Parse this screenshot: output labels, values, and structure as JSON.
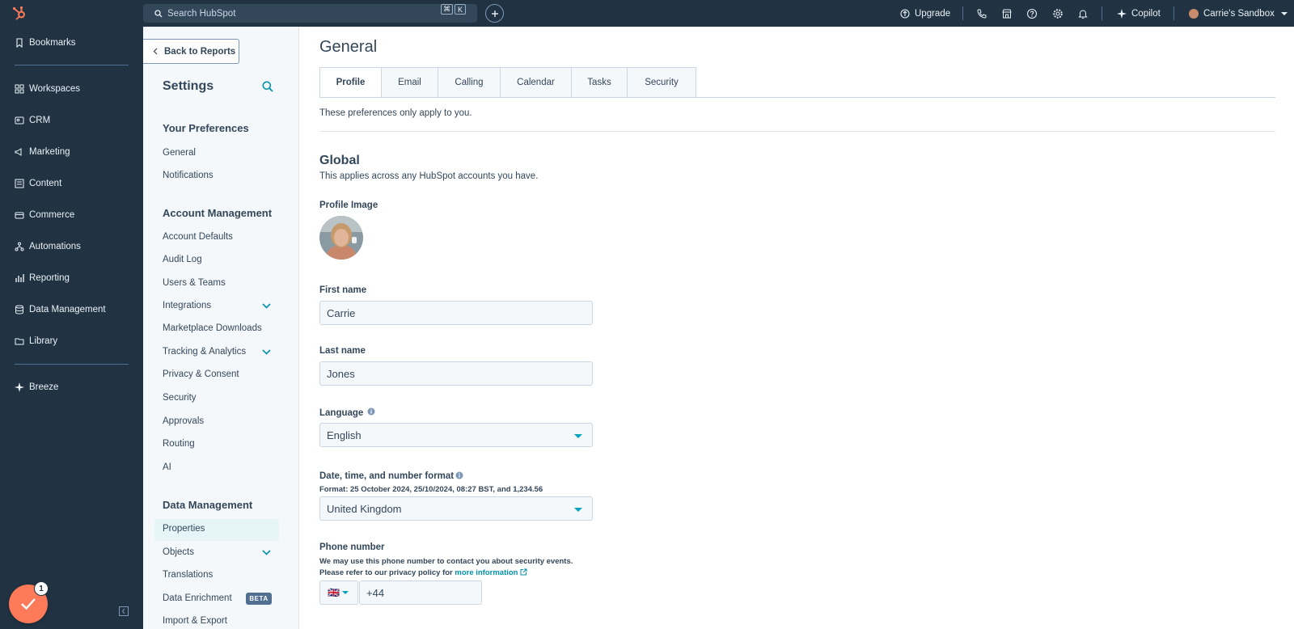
{
  "topbar": {
    "search_placeholder": "Search HubSpot",
    "shortcut_cmd": "⌘",
    "shortcut_key": "K",
    "upgrade": "Upgrade",
    "copilot": "Copilot",
    "account": "Carrie's Sandbox"
  },
  "leftnav": {
    "items": [
      {
        "label": "Bookmarks",
        "icon": "bookmark-icon"
      },
      {
        "label": "Workspaces",
        "icon": "workspaces-icon"
      },
      {
        "label": "CRM",
        "icon": "crm-icon"
      },
      {
        "label": "Marketing",
        "icon": "marketing-icon"
      },
      {
        "label": "Content",
        "icon": "content-icon"
      },
      {
        "label": "Commerce",
        "icon": "commerce-icon"
      },
      {
        "label": "Automations",
        "icon": "automations-icon"
      },
      {
        "label": "Reporting",
        "icon": "reporting-icon"
      },
      {
        "label": "Data Management",
        "icon": "data-management-icon"
      },
      {
        "label": "Library",
        "icon": "library-icon"
      },
      {
        "label": "Breeze",
        "icon": "breeze-icon"
      }
    ],
    "notification_count": "1"
  },
  "settings": {
    "back": "Back to Reports",
    "title": "Settings",
    "your_preferences": "Your Preferences",
    "pref_links": [
      "General",
      "Notifications"
    ],
    "account_management": "Account Management",
    "account_links": [
      "Account Defaults",
      "Audit Log",
      "Users & Teams",
      "Integrations",
      "Marketplace Downloads",
      "Tracking & Analytics",
      "Privacy & Consent",
      "Security",
      "Approvals",
      "Routing",
      "AI"
    ],
    "data_management": "Data Management",
    "data_links": [
      "Properties",
      "Objects",
      "Translations",
      "Data Enrichment",
      "Import & Export"
    ],
    "beta": "BETA"
  },
  "main": {
    "title": "General",
    "tabs": [
      "Profile",
      "Email",
      "Calling",
      "Calendar",
      "Tasks",
      "Security"
    ],
    "intro": "These preferences only apply to you.",
    "global_title": "Global",
    "global_desc": "This applies across any HubSpot accounts you have.",
    "profile_image_label": "Profile Image",
    "first_name_label": "First name",
    "first_name": "Carrie",
    "last_name_label": "Last name",
    "last_name": "Jones",
    "language_label": "Language",
    "language": "English",
    "format_label": "Date, time, and number format",
    "format_help": "Format: 25 October 2024, 25/10/2024, 08:27 BST, and 1,234.56",
    "format_value": "United Kingdom",
    "phone_label": "Phone number",
    "phone_help_1": "We may use this phone number to contact you about security events.",
    "phone_help_2": "Please refer to our privacy policy for ",
    "phone_help_link": "more information",
    "phone_flag": "🇬🇧",
    "phone_value": "+44"
  },
  "colors": {
    "nav_bg": "#213343",
    "accent": "#00a4bd",
    "fab": "#ff7a59"
  }
}
